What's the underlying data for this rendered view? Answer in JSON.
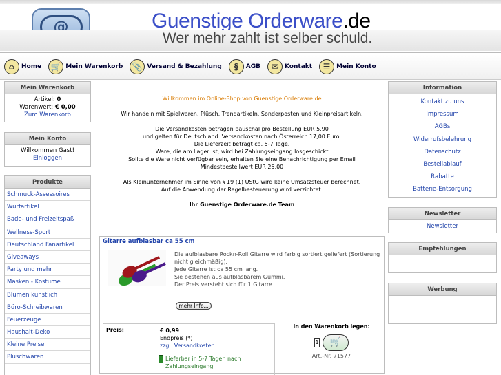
{
  "header": {
    "title_main": "Guenstige Orderware",
    "title_tld": ".de",
    "subtitle": "Wer mehr zahlt ist selber schuld.",
    "logo_text": "@"
  },
  "nav": [
    {
      "label": "Home",
      "icon": "⌂"
    },
    {
      "label": "Mein Warenkorb",
      "icon": "🛒"
    },
    {
      "label": "Versand & Bezahlung",
      "icon": "📎"
    },
    {
      "label": "AGB",
      "icon": "§"
    },
    {
      "label": "Kontakt",
      "icon": "✉"
    },
    {
      "label": "Mein Konto",
      "icon": "☰"
    }
  ],
  "cart_box": {
    "title": "Mein Warenkorb",
    "items_label": "Artikel:",
    "items_value": "0",
    "value_label": "Warenwert:",
    "value_value": "€ 0,00",
    "link": "Zum Warenkorb"
  },
  "account_box": {
    "title": "Mein Konto",
    "greeting": "Willkommen Gast!",
    "login": "Einloggen"
  },
  "products_box": {
    "title": "Produkte",
    "categories": [
      "Schmuck-Assessoires",
      "Wurfartikel",
      "Bade- und Freizeitspaß",
      "Wellness-Sport",
      "Deutschland Fanartikel",
      "Giveaways",
      "Party und mehr",
      "Masken - Kostüme",
      "Blumen künstlich",
      "Büro-Schreibwaren",
      "Feuerzeuge",
      "Haushalt-Deko",
      "Kleine Preise",
      "Plüschwaren"
    ]
  },
  "info_box": {
    "title": "Information",
    "links": [
      "Kontakt zu uns",
      "Impressum",
      "AGBs",
      "Widerrufsbelehrung",
      "Datenschutz",
      "Bestellablauf",
      "Rabatte",
      "Batterie-Entsorgung"
    ]
  },
  "newsletter_box": {
    "title": "Newsletter",
    "link": "Newsletter"
  },
  "empfehlungen_box": {
    "title": "Empfehlungen"
  },
  "werbung_box": {
    "title": "Werbung"
  },
  "welcome": {
    "headline": "Willkommen im Online-Shop von Guenstige Orderware.de",
    "line1": "Wir handeln mit Spielwaren, Plüsch, Trendartikeln, Sonderposten und Kleinpreisartikeln.",
    "line2": "Die Versandkosten betragen pauschal pro Bestellung EUR 5,90",
    "line3": "und gelten für Deutschland. Versandkosten nach Österreich 17,00 Euro.",
    "line4": "Die Lieferzeit beträgt ca. 5-7 Tage.",
    "line5": "Ware, die am Lager ist, wird bei Zahlungseingang losgeschickt",
    "line6": "Sollte die Ware nicht verfügbar sein, erhalten Sie eine Benachrichtigung per Email",
    "line7": "Mindestbestellwert EUR 25,00",
    "line8": "Als Kleinunternehmer im Sinne von § 19 (1) UStG wird keine Umsatzsteuer berechnet.",
    "line9": "Auf die Anwendung der Regelbesteuerung wird verzichtet.",
    "team": "Ihr Guenstige Orderware.de Team"
  },
  "product": {
    "title": "Gitarre aufblasbar ca 55 cm",
    "desc1": "Die aufblasbare Rockn-Roll Gitarre wird farbig sortiert geliefert (Sortierung nicht gleichmäßig).",
    "desc2": "Jede Gitarre ist ca 55 cm lang.",
    "desc3": "Sie bestehen aus aufblasbarem Gummi.",
    "desc4": "Der Preis versteht sich für 1 Gitarre.",
    "more": "mehr Info...",
    "price_label": "Preis:",
    "price": "€ 0,99",
    "endpreis": "Endpreis (*)",
    "versand": "zzgl. Versandkosten",
    "delivery": "Lieferbar in 5-7 Tagen nach Zahlungseingang",
    "cart_label": "In den Warenkorb legen:",
    "qty": "1",
    "artnr": "Art.-Nr. 71577"
  }
}
